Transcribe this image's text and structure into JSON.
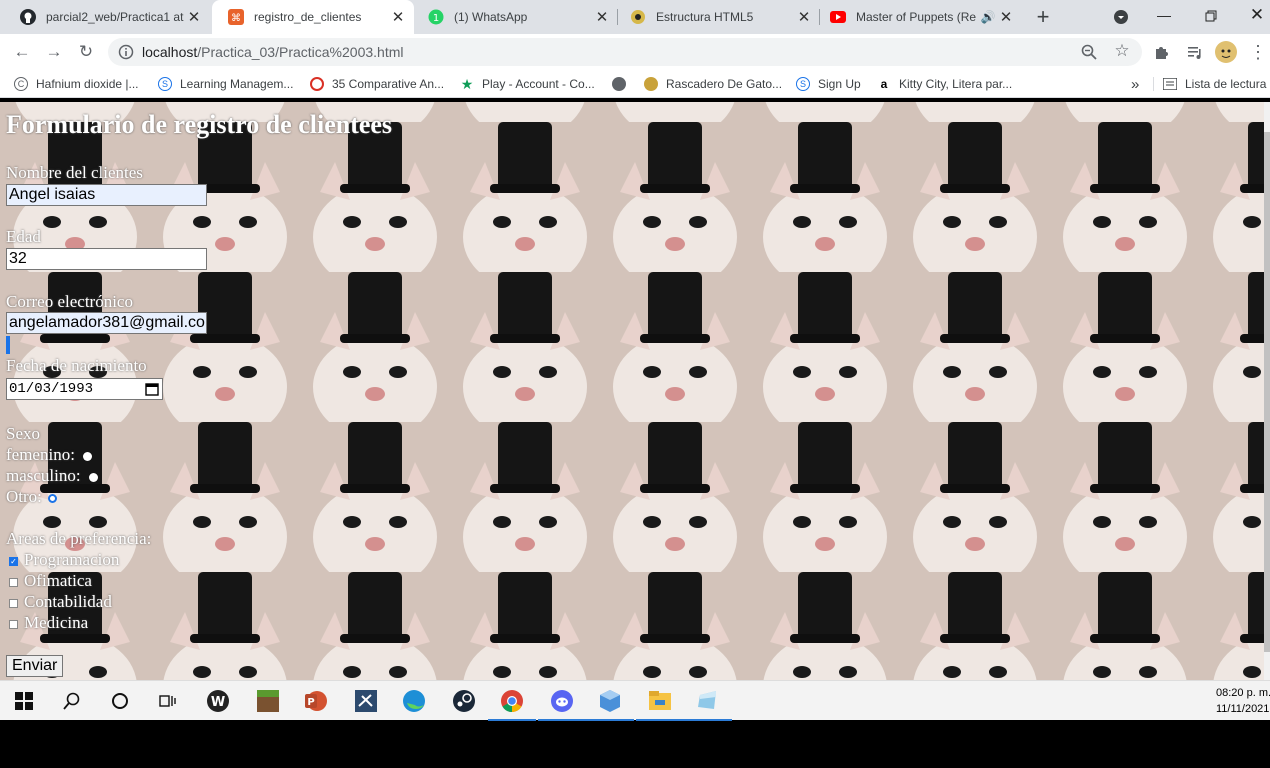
{
  "tabs": [
    {
      "title": "parcial2_web/Practica1 at",
      "icon": "github-icon"
    },
    {
      "title": "registro_de_clientes",
      "icon": "html-file-icon",
      "active": true
    },
    {
      "title": "(1) WhatsApp",
      "icon": "whatsapp-icon"
    },
    {
      "title": "Estructura HTML5",
      "icon": "page-favicon-icon"
    },
    {
      "title": "Master of Puppets (Re",
      "icon": "youtube-icon",
      "audio": true
    }
  ],
  "new_tab_label": "+",
  "address": {
    "host": "localhost",
    "path": "/Practica_03/Practica%2003.html"
  },
  "bookmarks": [
    {
      "label": "Hafnium dioxide |...",
      "icon": "google-scholar-icon"
    },
    {
      "label": "Learning Managem...",
      "icon": "s-circle-icon"
    },
    {
      "label": "35 Comparative An...",
      "icon": "red-logo-icon"
    },
    {
      "label": "Play - Account - Co...",
      "icon": "play-star-icon"
    },
    {
      "label": "",
      "icon": "globe-icon"
    },
    {
      "label": "Rascadero De Gato...",
      "icon": "cat-shop-icon"
    },
    {
      "label": "Sign Up",
      "icon": "s-circle-icon"
    },
    {
      "label": "Kitty City, Litera par...",
      "icon": "amazon-icon"
    }
  ],
  "bookmarks_more": "»",
  "reading_list": "Lista de lectura",
  "form": {
    "title": "Formulario de registro de clientees",
    "name_label": "Nombre del clientes",
    "name_value": "Angel isaias",
    "age_label": "Edad",
    "age_value": "32",
    "email_label": "Correo electrónico",
    "email_value": "angelamador381@gmail.co",
    "birth_label": "Fecha de nacimiento",
    "birth_value": "01/03/1993",
    "sex_label": "Sexo",
    "sex_options": [
      "femenino:",
      "masculino:",
      "Otro:"
    ],
    "sex_selected": "Otro:",
    "areas_label": "Areas de preferencia:",
    "areas": [
      {
        "label": "Programacion",
        "checked": true
      },
      {
        "label": "Ofimatica",
        "checked": false
      },
      {
        "label": "Contabilidad",
        "checked": false
      },
      {
        "label": "Medicina",
        "checked": false
      }
    ],
    "submit_label": "Enviar"
  },
  "taskbar": {
    "time": "08:20 p. m.",
    "date": "11/11/2021"
  }
}
